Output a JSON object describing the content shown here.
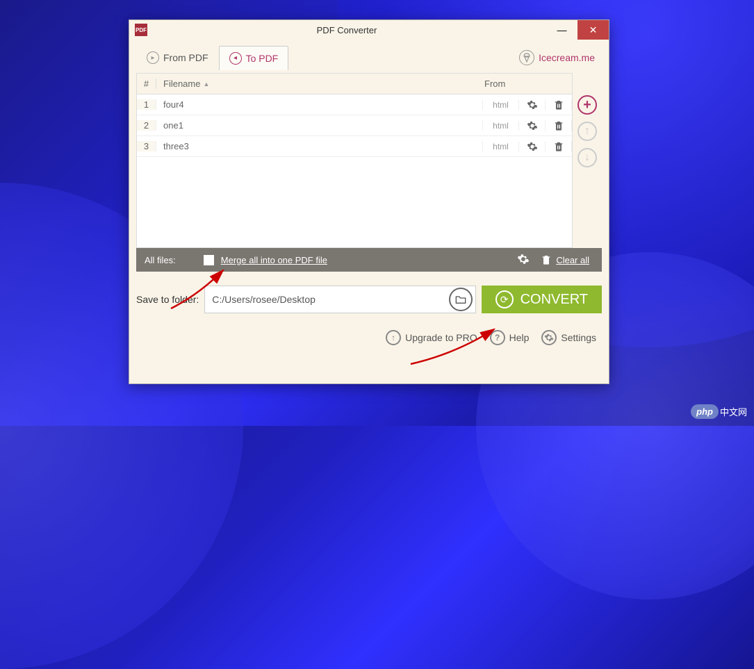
{
  "window": {
    "title": "PDF Converter",
    "icon_text": "PDF"
  },
  "tabs": {
    "from_pdf": "From PDF",
    "to_pdf": "To PDF"
  },
  "brand": {
    "label": "Icecream.me"
  },
  "table": {
    "headers": {
      "num": "#",
      "filename": "Filename",
      "from": "From"
    },
    "rows": [
      {
        "num": "1",
        "filename": "four4",
        "from": "html"
      },
      {
        "num": "2",
        "filename": "one1",
        "from": "html"
      },
      {
        "num": "3",
        "filename": "three3",
        "from": "html"
      }
    ]
  },
  "footer": {
    "all_files": "All files:",
    "merge_label": "Merge all into one PDF file",
    "clear_all": "Clear all"
  },
  "save": {
    "label": "Save to folder:",
    "path": "C:/Users/rosee/Desktop",
    "convert": "CONVERT"
  },
  "bottom": {
    "upgrade": "Upgrade to PRO",
    "help": "Help",
    "settings": "Settings"
  },
  "watermark": {
    "php": "php",
    "cn": "中文网"
  }
}
